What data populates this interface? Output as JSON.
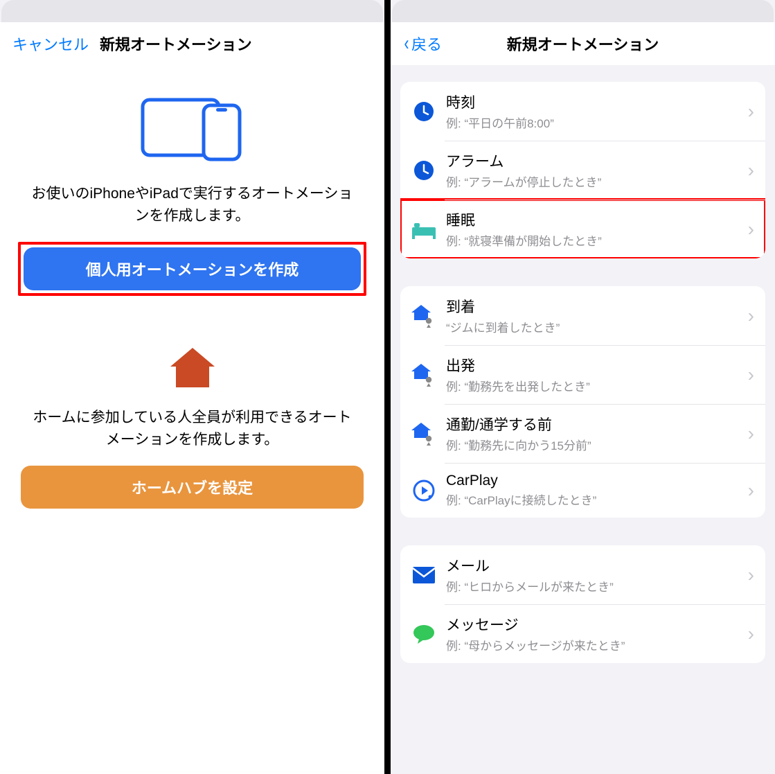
{
  "left": {
    "cancel": "キャンセル",
    "title": "新規オートメーション",
    "desc1": "お使いのiPhoneやiPadで実行するオートメーションを作成します。",
    "btn1": "個人用オートメーションを作成",
    "desc2": "ホームに参加している人全員が利用できるオートメーションを作成します。",
    "btn2": "ホームハブを設定"
  },
  "right": {
    "back": "戻る",
    "title": "新規オートメーション",
    "group1": [
      {
        "icon": "clock",
        "title": "時刻",
        "sub": "例: “平日の午前8:00”"
      },
      {
        "icon": "clock",
        "title": "アラーム",
        "sub": "例: “アラームが停止したとき”"
      },
      {
        "icon": "bed",
        "title": "睡眠",
        "sub": "例: “就寝準備が開始したとき”",
        "highlight": true
      }
    ],
    "group2": [
      {
        "icon": "arrive",
        "title": "到着",
        "sub": "“ジムに到着したとき”"
      },
      {
        "icon": "leave",
        "title": "出発",
        "sub": "例: “勤務先を出発したとき”"
      },
      {
        "icon": "commute",
        "title": "通勤/通学する前",
        "sub": "例: “勤務先に向かう15分前”"
      },
      {
        "icon": "carplay",
        "title": "CarPlay",
        "sub": "例: “CarPlayに接続したとき”"
      }
    ],
    "group3": [
      {
        "icon": "mail",
        "title": "メール",
        "sub": "例: “ヒロからメールが来たとき”"
      },
      {
        "icon": "message",
        "title": "メッセージ",
        "sub": "例: “母からメッセージが来たとき”"
      }
    ]
  }
}
